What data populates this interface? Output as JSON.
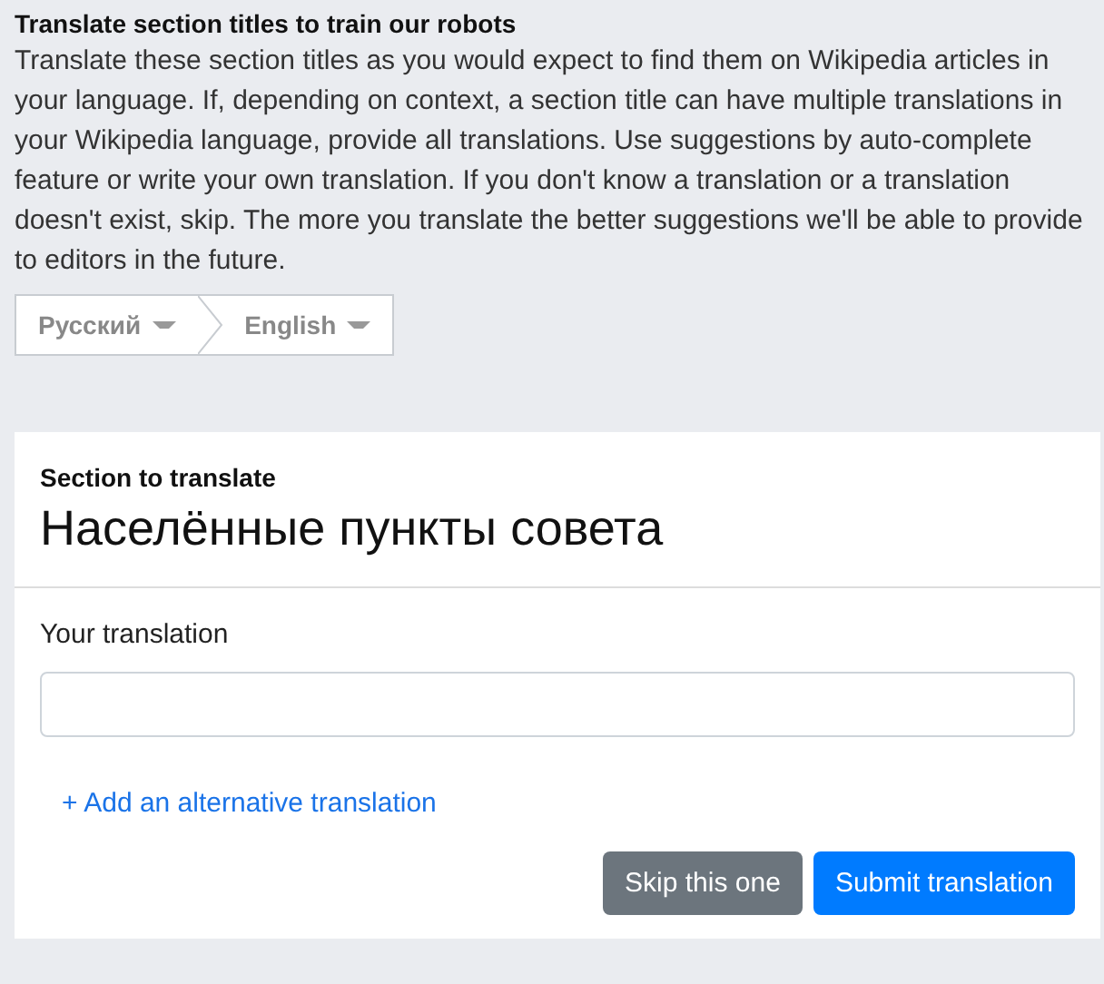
{
  "intro": {
    "title": "Translate section titles to train our robots",
    "text": "Translate these section titles as you would expect to find them on Wikipedia articles in your language. If, depending on context, a section title can have multiple translations in your Wikipedia language, provide all translations. Use suggestions by auto-complete feature or write your own translation. If you don't know a translation or a translation doesn't exist, skip. The more you translate the better suggestions we'll be able to provide to editors in the future."
  },
  "languages": {
    "source": "Русский",
    "target": "English"
  },
  "card": {
    "section_label": "Section to translate",
    "section_title": "Населённые пункты совета",
    "translation_label": "Your translation",
    "add_link": "+ Add an alternative translation",
    "buttons": [
      {
        "label": "Skip this one",
        "kind": "secondary"
      },
      {
        "label": "Submit translation",
        "kind": "primary"
      }
    ]
  }
}
